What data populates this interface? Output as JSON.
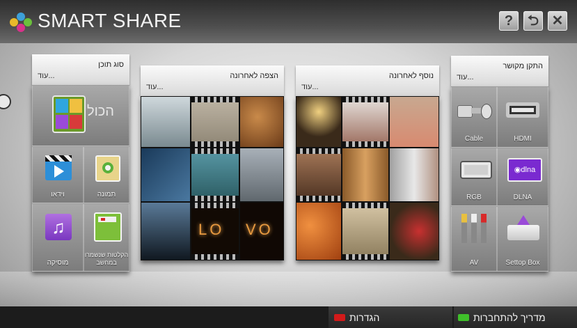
{
  "header": {
    "title": "SMART SHARE",
    "help_glyph": "?",
    "back_glyph": "⮌",
    "close_glyph": "✕"
  },
  "panels": {
    "content_type": {
      "title": "סוג תוכן",
      "more": "עוד...",
      "tiles": [
        {
          "label": "הכול",
          "icon": "all-media-icon"
        },
        {
          "label": "תמונה",
          "icon": "photo-icon"
        },
        {
          "label": "וידאו",
          "icon": "video-icon"
        },
        {
          "label": "הקלטות שנשמרו במחשב",
          "icon": "recordings-icon"
        },
        {
          "label": "מוסיקה",
          "icon": "music-icon"
        }
      ]
    },
    "recently_watched": {
      "title": "הצפה לאחרונה",
      "more": "עוד..."
    },
    "recently_added": {
      "title": "נוסף לאחרונה",
      "more": "עוד..."
    },
    "connected_device": {
      "title": "התקן מקושר",
      "more": "עוד...",
      "tiles": [
        {
          "label": "HDMI",
          "icon": "hdmi-icon"
        },
        {
          "label": "Cable",
          "icon": "cable-icon"
        },
        {
          "label": "DLNA",
          "icon": "dlna-icon"
        },
        {
          "label": "RGB",
          "icon": "rgb-icon"
        },
        {
          "label": "Settop Box",
          "icon": "settop-box-icon"
        },
        {
          "label": "AV",
          "icon": "av-icon"
        }
      ]
    }
  },
  "footer": {
    "settings_label": "הגדרות",
    "settings_key_color": "#d21a1a",
    "guide_label": "מדריך להתחברות",
    "guide_key_color": "#3fbf2a"
  }
}
